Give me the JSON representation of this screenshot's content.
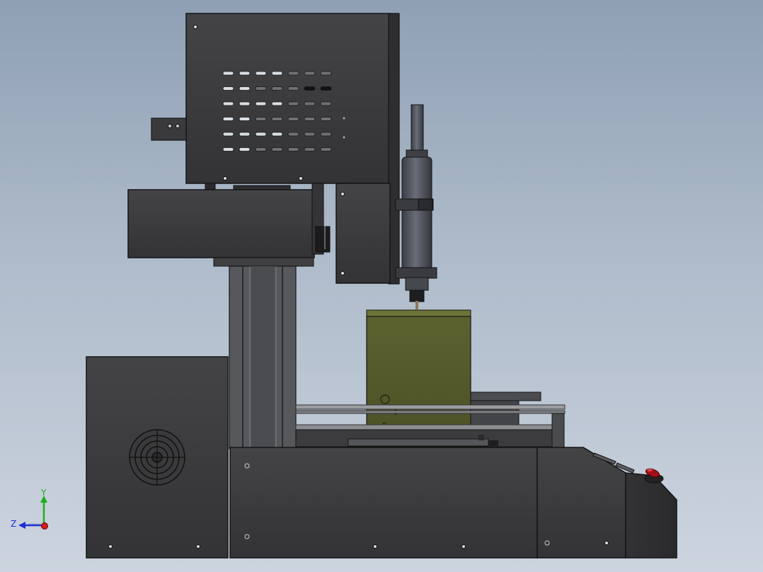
{
  "viewport": {
    "background_top": "#8fa0b4",
    "background_bottom": "#cdd4df"
  },
  "colors": {
    "body_dark": "#3b3b3c",
    "body_mid": "#454546",
    "edge": "#151515",
    "extrusion": "#5a5c60",
    "spindle": "#4c4e56",
    "workpiece": "#555a2c",
    "workpiece_top": "#6d7436",
    "rail": "#9a9ca0",
    "estop_red": "#a01018"
  },
  "triad": {
    "y_label": "Y",
    "z_label": "Z",
    "y_color": "#19b219",
    "z_color": "#1d2fd6",
    "x_color": "#d61d1d"
  }
}
